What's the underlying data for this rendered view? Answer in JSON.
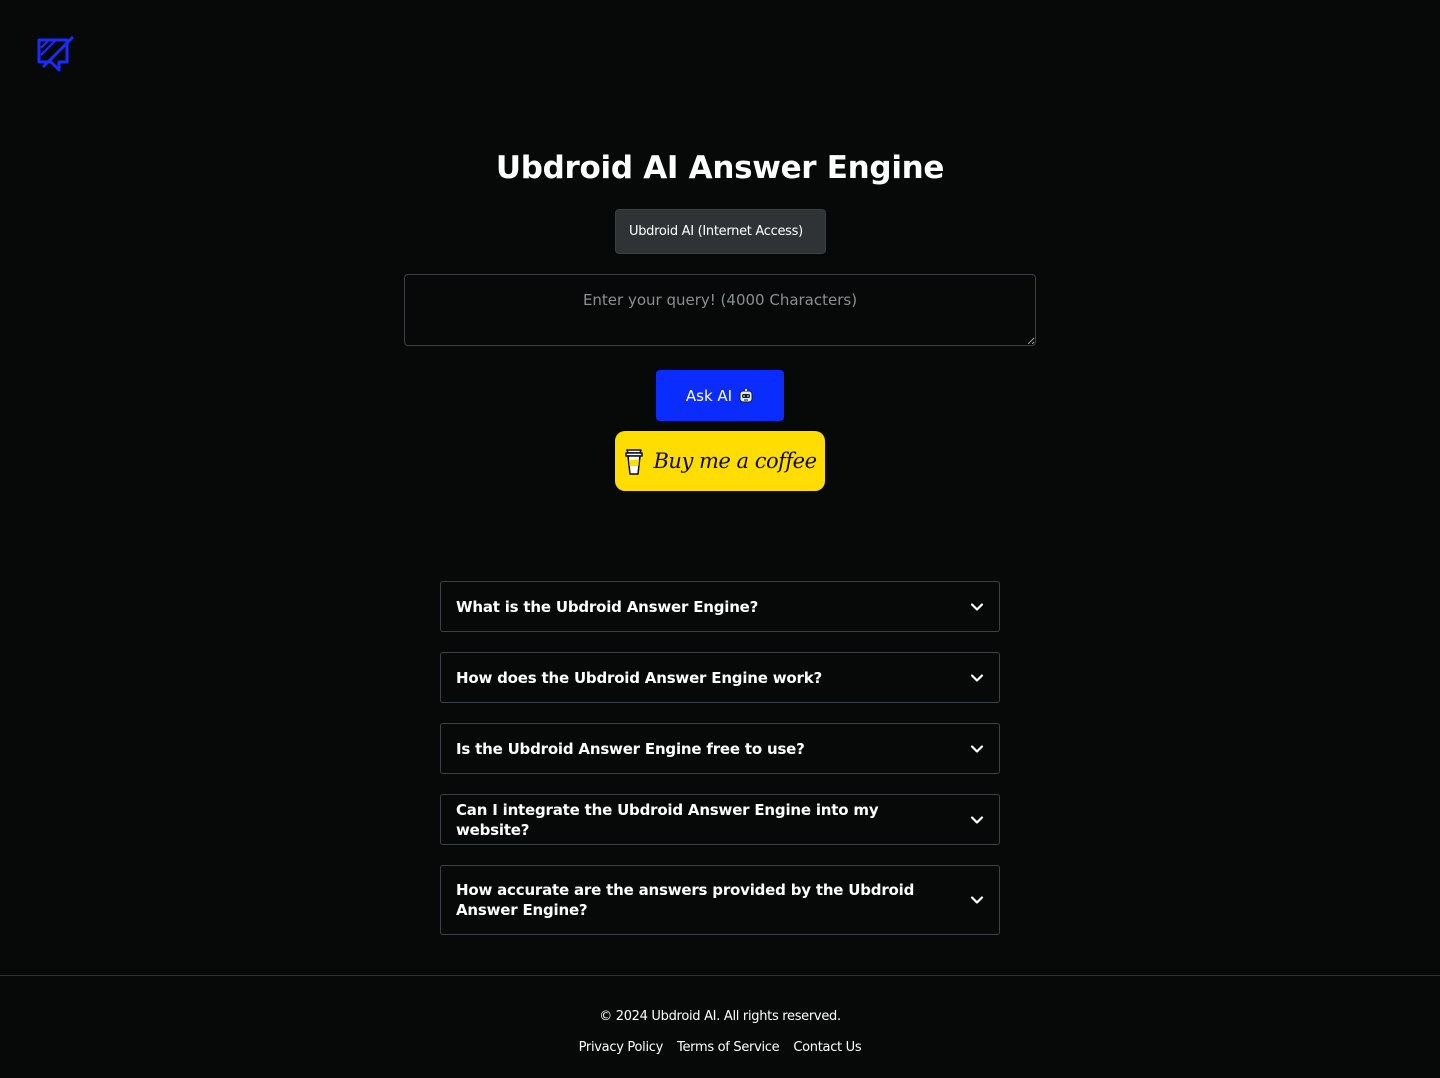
{
  "header": {
    "logo_icon": "ubdroid-logo-icon",
    "logo_color": "#1a2bff"
  },
  "main": {
    "title": "Ubdroid AI Answer Engine",
    "model_select": {
      "selected": "Ubdroid AI (Internet Access)"
    },
    "query": {
      "placeholder": "Enter your query! (4000 Characters)",
      "value": ""
    },
    "ask_button": {
      "label": "Ask AI",
      "icon": "robot-icon"
    },
    "coffee_button": {
      "label": "Buy me a coffee",
      "icon": "coffee-cup-icon"
    }
  },
  "faq": {
    "items": [
      {
        "question": "What is the Ubdroid Answer Engine?"
      },
      {
        "question": "How does the Ubdroid Answer Engine work?"
      },
      {
        "question": "Is the Ubdroid Answer Engine free to use?"
      },
      {
        "question": "Can I integrate the Ubdroid Answer Engine into my website?"
      },
      {
        "question": "How accurate are the answers provided by the Ubdroid Answer Engine?"
      }
    ]
  },
  "footer": {
    "copyright": "© 2024 Ubdroid AI. All rights reserved.",
    "links": [
      "Privacy Policy",
      "Terms of Service",
      "Contact Us"
    ]
  },
  "colors": {
    "background": "#070909",
    "primary": "#0b2cff",
    "coffee": "#ffdd00",
    "border": "#3c4145"
  }
}
